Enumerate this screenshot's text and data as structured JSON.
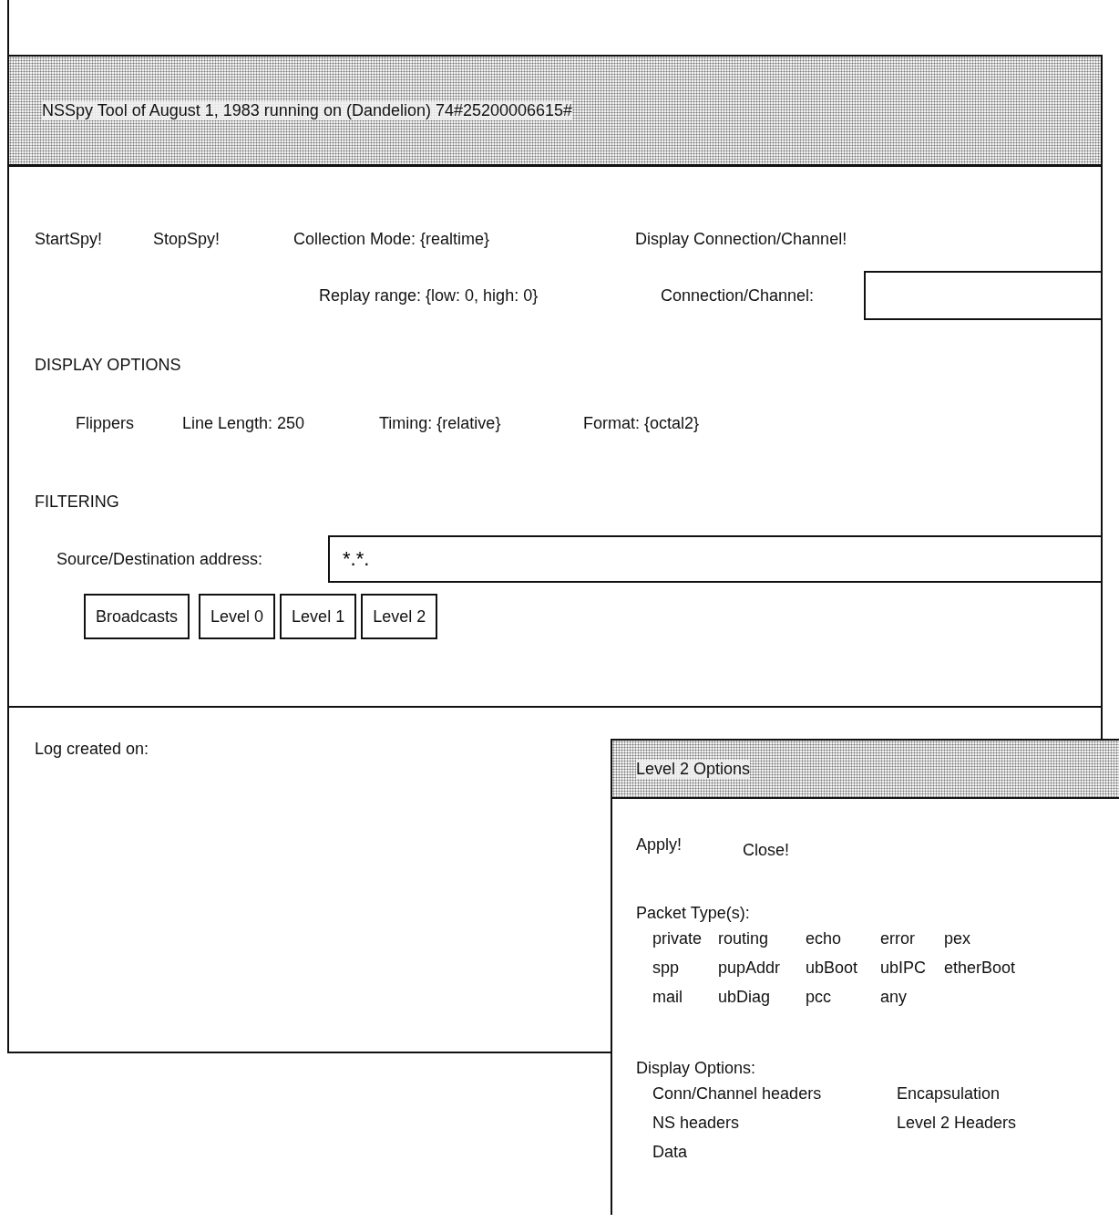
{
  "window": {
    "title": "NSSpy Tool of August 1, 1983 running on (Dandelion) 74#25200006615#"
  },
  "commands": [
    "StartSpy!",
    "StopSpy!"
  ],
  "collection_mode": "Collection Mode: {realtime}",
  "display_command": "Display Connection/Channel!",
  "replay_range": "Replay range: {low: 0, high: 0}",
  "connection_field": {
    "label": "Connection/Channel:"
  },
  "display_options": {
    "heading": "DISPLAY OPTIONS",
    "items": [
      "Flippers",
      "Line Length: 250",
      "Timing: {relative}",
      "Format: {octal2}"
    ]
  },
  "filtering": {
    "heading": "FILTERING",
    "address_field": {
      "label": "Source/Destination address:",
      "value": "*.*."
    },
    "buttons": [
      "Broadcasts",
      "Level 0",
      "Level 1",
      "Level 2"
    ]
  },
  "log": {
    "label": "Log created on:"
  },
  "options_window": {
    "title": "Level 2 Options",
    "commands": [
      "Apply!",
      "Close!"
    ],
    "packet_types": {
      "heading": "Packet Type(s):",
      "rows": [
        [
          "private",
          "routing",
          "echo",
          "error",
          "pex"
        ],
        [
          "spp",
          "pupAddr",
          "ubBoot",
          "ubIPC",
          "etherBoot"
        ],
        [
          "mail",
          "ubDiag",
          "pcc",
          "any"
        ]
      ]
    },
    "display_options": {
      "heading": "Display Options:",
      "columns": [
        [
          "Conn/Channel headers",
          "NS headers",
          "Data"
        ],
        [
          "Encapsulation",
          "Level 2 Headers"
        ]
      ]
    }
  }
}
